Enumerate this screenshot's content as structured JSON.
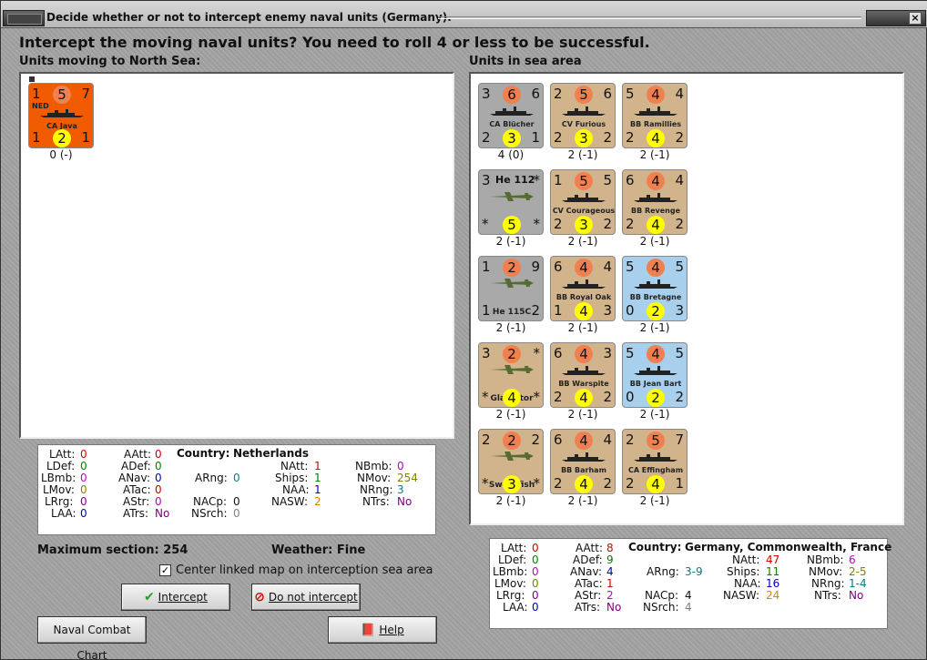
{
  "window": {
    "title": "Decide whether or not to intercept enemy naval units (Germany).",
    "close_glyph": "×"
  },
  "question": "Intercept the moving naval units?  You need to roll 4 or less to be successful.",
  "left_panel": {
    "label": "Units moving to North Sea:",
    "units": [
      {
        "tl": "1",
        "tc": "5",
        "tr": "7",
        "flag": "NED",
        "name": "CA Java",
        "bl": "1",
        "bc": "2",
        "br": "1",
        "caption": "0 (-)"
      }
    ]
  },
  "right_panel": {
    "label": "Units in sea area",
    "rows": [
      [
        {
          "tl": "3",
          "tc": "6",
          "tr": "6",
          "name": "CA Blücher",
          "bl": "2",
          "bc": "3",
          "br": "1",
          "caption": "4 (0)",
          "color": "#a9a9a9"
        },
        {
          "tl": "2",
          "tc": "5",
          "tr": "6",
          "name": "CV Furious",
          "bl": "2",
          "bc": "3",
          "br": "2",
          "caption": "2 (-1)",
          "color": "#d2b48c"
        },
        {
          "tl": "5",
          "tc": "4",
          "tr": "4",
          "name": "BB Ramillies",
          "bl": "2",
          "bc": "4",
          "br": "2",
          "caption": "2 (-1)",
          "color": "#d2b48c"
        }
      ],
      [
        {
          "tl": "3",
          "tc": "He 112",
          "tr": "*",
          "name": "",
          "bl": "*",
          "bc": "5",
          "br": "*",
          "caption": "2 (-1)",
          "color": "#a9a9a9"
        },
        {
          "tl": "1",
          "tc": "5",
          "tr": "5",
          "name": "CV Courageous",
          "bl": "2",
          "bc": "3",
          "br": "2",
          "caption": "2 (-1)",
          "color": "#d2b48c"
        },
        {
          "tl": "6",
          "tc": "4",
          "tr": "4",
          "name": "BB Revenge",
          "bl": "2",
          "bc": "4",
          "br": "2",
          "caption": "2 (-1)",
          "color": "#d2b48c"
        }
      ],
      [
        {
          "tl": "1",
          "tc": "2",
          "tr": "9",
          "name": "He 115C",
          "bl": "1",
          "bc": "",
          "br": "2",
          "caption": "2 (-1)",
          "color": "#a9a9a9"
        },
        {
          "tl": "6",
          "tc": "4",
          "tr": "4",
          "name": "BB Royal Oak",
          "bl": "1",
          "bc": "4",
          "br": "3",
          "caption": "2 (-1)",
          "color": "#d2b48c"
        },
        {
          "tl": "5",
          "tc": "4",
          "tr": "5",
          "name": "BB Bretagne",
          "bl": "0",
          "bc": "2",
          "br": "3",
          "caption": "2 (-1)",
          "color": "#a8d0ec"
        }
      ],
      [
        {
          "tl": "3",
          "tc": "2",
          "tr": "*",
          "name": "Gladiator",
          "bl": "*",
          "bc": "4",
          "br": "*",
          "caption": "2 (-1)",
          "color": "#d2b48c"
        },
        {
          "tl": "6",
          "tc": "4",
          "tr": "3",
          "name": "BB Warspite",
          "bl": "2",
          "bc": "4",
          "br": "2",
          "caption": "2 (-1)",
          "color": "#d2b48c"
        },
        {
          "tl": "5",
          "tc": "4",
          "tr": "5",
          "name": "BB Jean Bart",
          "bl": "0",
          "bc": "2",
          "br": "2",
          "caption": "2 (-1)",
          "color": "#a8d0ec"
        }
      ],
      [
        {
          "tl": "2",
          "tc": "2",
          "tr": "2",
          "name": "Swordfish",
          "bl": "*",
          "bc": "3",
          "br": "*",
          "caption": "2 (-1)",
          "color": "#d2b48c"
        },
        {
          "tl": "6",
          "tc": "4",
          "tr": "4",
          "name": "BB Barham",
          "bl": "2",
          "bc": "4",
          "br": "2",
          "caption": "2 (-1)",
          "color": "#d2b48c"
        },
        {
          "tl": "2",
          "tc": "5",
          "tr": "7",
          "name": "CA Effingham",
          "bl": "2",
          "bc": "4",
          "br": "1",
          "caption": "2 (-1)",
          "color": "#d2b48c"
        }
      ]
    ]
  },
  "left_stats": {
    "country_label": "Country:",
    "country": "Netherlands",
    "latt_l": "LAtt:",
    "latt": "0",
    "ldef_l": "LDef:",
    "ldef": "0",
    "lbmb_l": "LBmb:",
    "lbmb": "0",
    "lmov_l": "LMov:",
    "lmov": "0",
    "lrrg_l": "LRrg:",
    "lrrg": "0",
    "laa_l": "LAA:",
    "laa": "0",
    "aatt_l": "AAtt:",
    "aatt": "0",
    "adef_l": "ADef:",
    "adef": "0",
    "anav_l": "ANav:",
    "anav": "0",
    "atac_l": "ATac:",
    "atac": "0",
    "astr_l": "AStr:",
    "astr": "0",
    "atrs_l": "ATrs:",
    "atrs": "No",
    "arng_l": "ARng:",
    "arng": "0",
    "nacp_l": "NACp:",
    "nacp": "0",
    "nsrch_l": "NSrch:",
    "nsrch": "0",
    "natt_l": "NAtt:",
    "natt": "1",
    "ships_l": "Ships:",
    "ships": "1",
    "naa_l": "NAA:",
    "naa": "1",
    "nasw_l": "NASW:",
    "nasw": "2",
    "nbmb_l": "NBmb:",
    "nbmb": "0",
    "nmov_l": "NMov:",
    "nmov": "254",
    "nrng_l": "NRng:",
    "nrng": "3",
    "ntrs_l": "NTrs:",
    "ntrs": "No"
  },
  "right_stats": {
    "country_label": "Country:",
    "country": "Germany, Commonwealth, France",
    "latt_l": "LAtt:",
    "latt": "0",
    "ldef_l": "LDef:",
    "ldef": "0",
    "lbmb_l": "LBmb:",
    "lbmb": "0",
    "lmov_l": "LMov:",
    "lmov": "0",
    "lrrg_l": "LRrg:",
    "lrrg": "0",
    "laa_l": "LAA:",
    "laa": "0",
    "aatt_l": "AAtt:",
    "aatt": "8",
    "adef_l": "ADef:",
    "adef": "9",
    "anav_l": "ANav:",
    "anav": "4",
    "atac_l": "ATac:",
    "atac": "1",
    "astr_l": "AStr:",
    "astr": "2",
    "atrs_l": "ATrs:",
    "atrs": "No",
    "arng_l": "ARng:",
    "arng": "3-9",
    "nacp_l": "NACp:",
    "nacp": "4",
    "nsrch_l": "NSrch:",
    "nsrch": "4",
    "natt_l": "NAtt:",
    "natt": "47",
    "ships_l": "Ships:",
    "ships": "11",
    "naa_l": "NAA:",
    "naa": "16",
    "nasw_l": "NASW:",
    "nasw": "24",
    "nbmb_l": "NBmb:",
    "nbmb": "6",
    "nmov_l": "NMov:",
    "nmov": "2-5",
    "nrng_l": "NRng:",
    "nrng": "1-4",
    "ntrs_l": "NTrs:",
    "ntrs": "No"
  },
  "info": {
    "max_section": "Maximum section: 254",
    "weather": "Weather:  Fine",
    "center_checkbox_label": "Center linked map on interception sea area",
    "center_checked": true
  },
  "buttons": {
    "intercept": "Intercept",
    "do_not_intercept": "Do not intercept",
    "naval_combat_chart": "Naval Combat Chart",
    "help": "Help"
  }
}
